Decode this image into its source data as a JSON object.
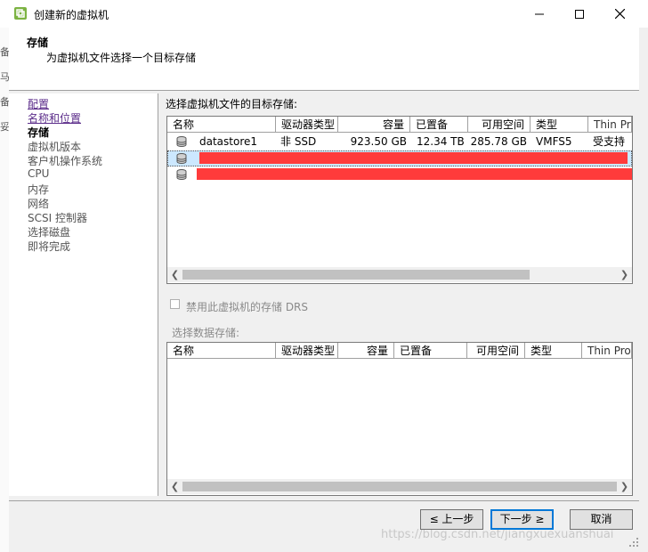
{
  "window": {
    "title": "创建新的虚拟机"
  },
  "header": {
    "title": "存储",
    "description": "为虚拟机文件选择一个目标存储"
  },
  "left_strip": {
    "chars": [
      "备",
      "马",
      "备",
      "妥"
    ]
  },
  "nav": {
    "items": [
      {
        "label": "配置",
        "state": "link"
      },
      {
        "label": "名称和位置",
        "state": "link"
      },
      {
        "label": "存储",
        "state": "current"
      },
      {
        "label": "虚拟机版本",
        "state": "disabled"
      },
      {
        "label": "客户机操作系统",
        "state": "disabled"
      },
      {
        "label": "CPU",
        "state": "disabled"
      },
      {
        "label": "内存",
        "state": "disabled"
      },
      {
        "label": "网络",
        "state": "disabled"
      },
      {
        "label": "SCSI 控制器",
        "state": "disabled"
      },
      {
        "label": "选择磁盘",
        "state": "disabled"
      },
      {
        "label": "即将完成",
        "state": "disabled"
      }
    ]
  },
  "main": {
    "target_label": "选择虚拟机文件的目标存储:",
    "columns": [
      "名称",
      "驱动器类型",
      "容量",
      "已置备",
      "可用空间",
      "类型",
      "Thin Prov"
    ],
    "rows": [
      {
        "name": "datastore1",
        "drive_type": "非 SSD",
        "capacity": "923.50 GB",
        "provisioned": "12.34 TB",
        "free": "285.78 GB",
        "type": "VMFS5",
        "thin": "受支持"
      }
    ],
    "drs_label": "禁用此虚拟机的存储 DRS",
    "select_datastore_label": "选择数据存储:",
    "columns2": [
      "名称",
      "驱动器类型",
      "容量",
      "已置备",
      "可用空间",
      "类型",
      "Thin Provi"
    ]
  },
  "buttons": {
    "back": "≤ 上一步",
    "next": "下一步 ≥",
    "cancel": "取消"
  },
  "watermark": "https://blog.csdn.net/jiangxuexuanshuai",
  "colors": {
    "redaction": "#ff3b3b",
    "selected_row": "#cce8ff",
    "link": "#5b2c8a"
  }
}
